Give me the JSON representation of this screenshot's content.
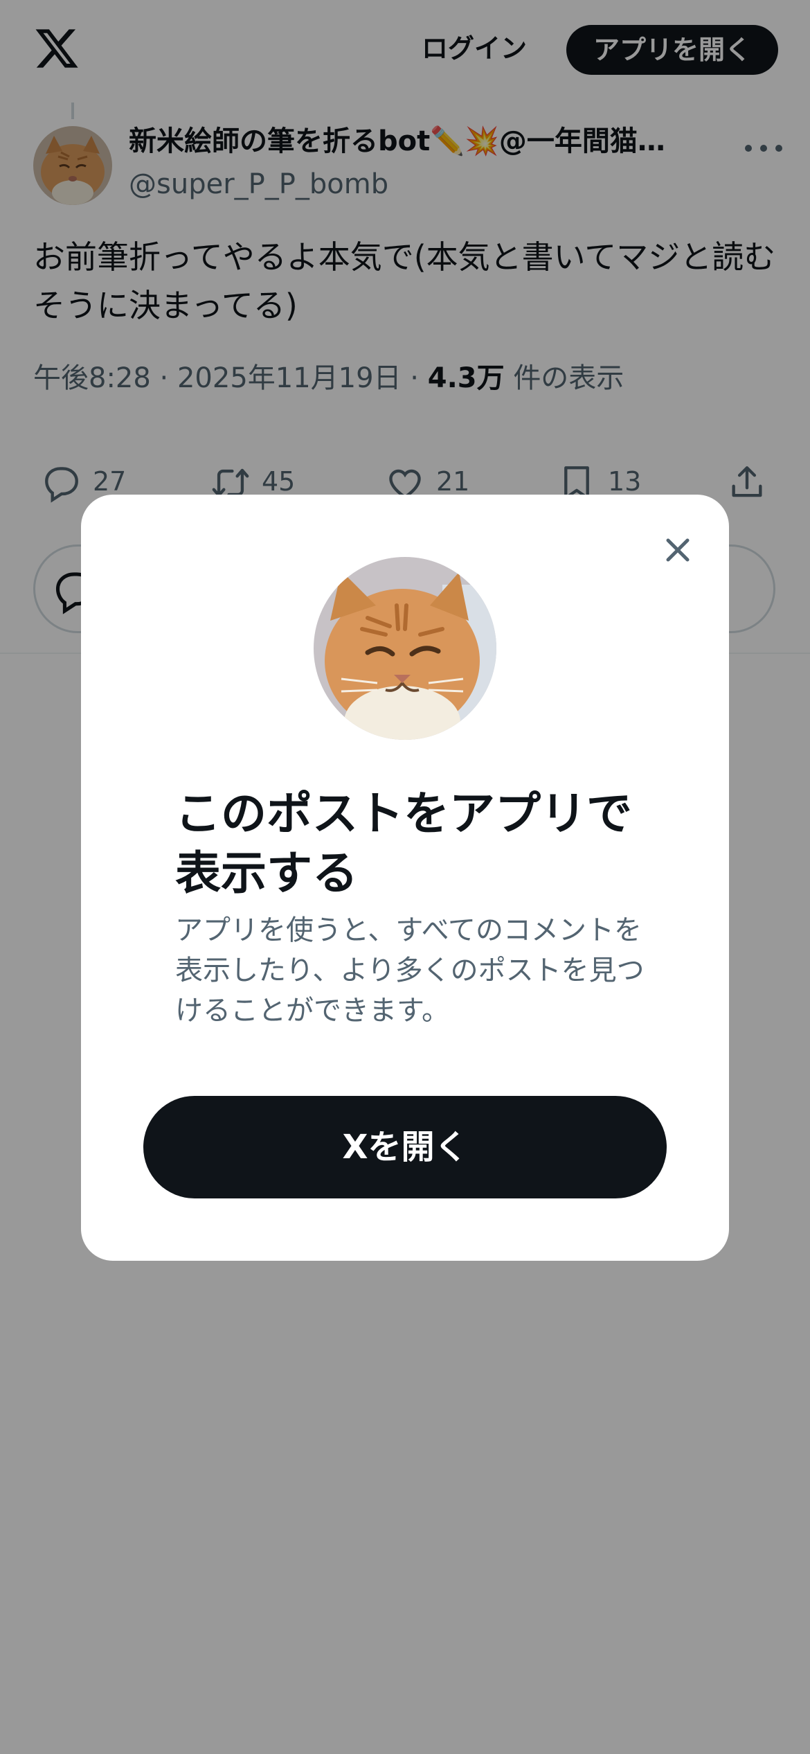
{
  "header": {
    "logo_icon": "x-logo-icon",
    "login_label": "ログイン",
    "open_app_label": "アプリを開く"
  },
  "tweet": {
    "display_name": "新米絵師の筆を折るbot✏️💥@一年間猫…",
    "handle": "@super_P_P_bomb",
    "text": "お前筆折ってやるよ本気で(本気と書いてマジと読むそうに決まってる)",
    "time": "午後8:28",
    "separator": "·",
    "date": "2025年11月19日",
    "views_count": "4.3万",
    "views_label": "件の表示",
    "actions": {
      "replies": "27",
      "reposts": "45",
      "likes": "21",
      "bookmarks": "13"
    }
  },
  "modal": {
    "title": "このポストをアプリで表示する",
    "description": "アプリを使うと、すべてのコメントを表示したり、より多くのポストを見つけることができます。",
    "button_label": "Xを開く",
    "close_icon": "close-icon"
  },
  "colors": {
    "text_primary": "#0f1419",
    "text_secondary": "#536471",
    "button_dark": "#0f1419",
    "overlay": "rgba(0,0,0,0.4)",
    "border": "#cfd9de"
  }
}
